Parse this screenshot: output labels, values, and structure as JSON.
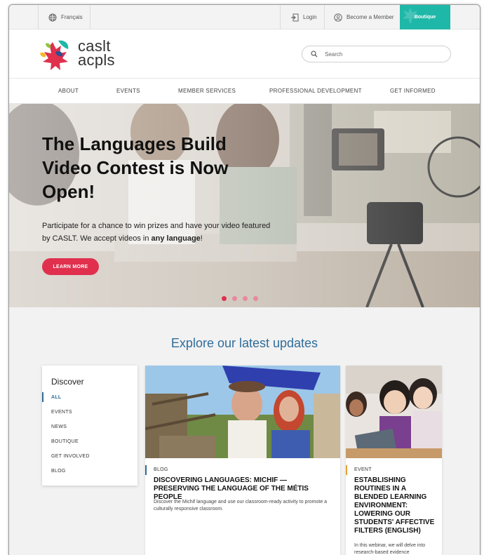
{
  "utility": {
    "language": "Français",
    "login": "Login",
    "become_member": "Become a Member",
    "boutique": "Boutique"
  },
  "logo": {
    "line1": "caslt",
    "line2": "acpls"
  },
  "search": {
    "placeholder": "Search"
  },
  "nav": [
    "ABOUT",
    "EVENTS",
    "MEMBER SERVICES",
    "PROFESSIONAL DEVELOPMENT",
    "GET INFORMED"
  ],
  "hero": {
    "title": "The Languages Build Video Contest is Now Open!",
    "text_before": "Participate for a chance to win prizes and have your video featured by CASLT. We accept videos in ",
    "text_bold": "any language",
    "text_after": "!",
    "button": "LEARN MORE",
    "slides": 4,
    "active_slide": 1
  },
  "updates": {
    "title": "Explore our latest updates",
    "filter_title": "Discover",
    "filters": [
      "ALL",
      "EVENTS",
      "NEWS",
      "BOUTIQUE",
      "GET INVOLVED",
      "BLOG"
    ],
    "active_filter": "ALL"
  },
  "cards": [
    {
      "tag": "BLOG",
      "title": "DISCOVERING LANGUAGES: MICHIF — PRESERVING THE LANGUAGE OF THE MÉTIS PEOPLE",
      "description": "Discover the Michif language and use our classroom-ready activity to promote a culturally responsive classroom.",
      "tag_color": "#2f6d9a"
    },
    {
      "tag": "EVENT",
      "title": "ESTABLISHING ROUTINES IN A BLENDED LEARNING ENVIRONMENT: LOWERING OUR STUDENTS' AFFECTIVE FILTERS (ENGLISH)",
      "description": "In this webinar, we will delve into research-based evidence",
      "tag_color": "#e8a23a"
    }
  ],
  "colors": {
    "accent": "#e0304e",
    "teal": "#1fb8a8",
    "blue": "#2f6d9a"
  }
}
